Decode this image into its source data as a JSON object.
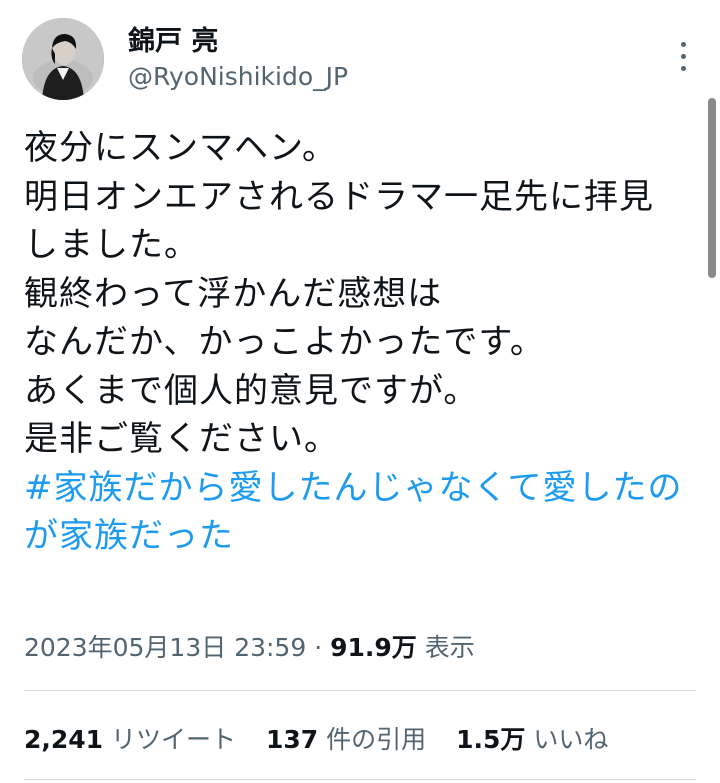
{
  "author": {
    "display_name": "錦戸 亮",
    "handle": "@RyoNishikido_JP",
    "avatar_icon": "profile-photo"
  },
  "tweet": {
    "lines": [
      "夜分にスンマヘン。",
      "明日オンエアされるドラマ一足先に拝見",
      "しました。",
      "観終わって浮かんだ感想は",
      "なんだか、かっこよかったです。",
      "あくまで個人的意見ですが。",
      "是非ご覧ください。"
    ],
    "hashtag_lines": [
      "#家族だから愛したんじゃなくて愛したの",
      "が家族だった"
    ]
  },
  "meta": {
    "timestamp": "2023年05月13日 23:59",
    "separator": " · ",
    "views_count": "91.9万",
    "views_label": " 表示"
  },
  "stats": {
    "retweets": "2,241",
    "retweets_label": "リツイート",
    "quotes": "137",
    "quotes_label": "件の引用",
    "likes": "1.5万",
    "likes_label": "いいね"
  },
  "colors": {
    "text": "#0f1419",
    "secondary": "#536471",
    "link": "#1d9bf0",
    "divider": "#cfd9de"
  },
  "more_icon": "more-vertical-icon"
}
